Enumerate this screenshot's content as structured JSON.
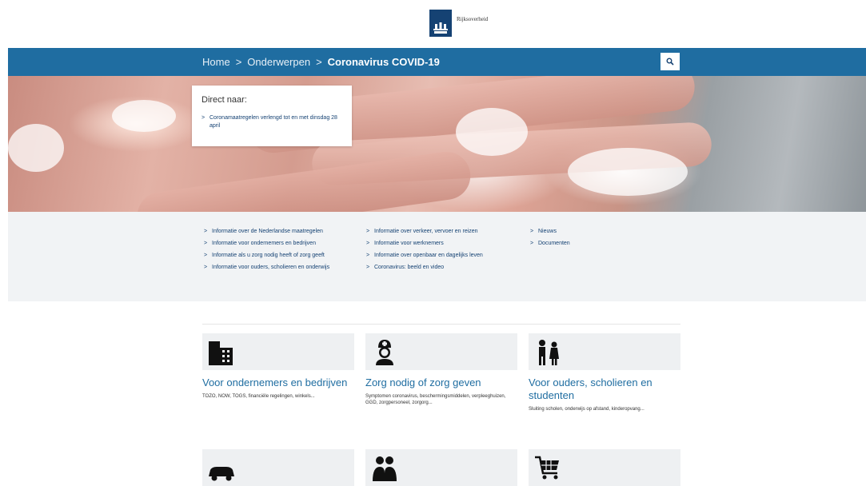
{
  "header": {
    "logo_text": "Rijksoverheid"
  },
  "navbar": {
    "breadcrumb": {
      "home": "Home",
      "section": "Onderwerpen",
      "current": "Coronavirus COVID-19",
      "separator": ">"
    },
    "search_icon": "search-icon"
  },
  "hero": {
    "direct_title": "Direct naar:",
    "direct_link": "Coronamaatregelen verlengd tot en met dinsdag 28 april"
  },
  "links": {
    "column1": [
      "Informatie over de Nederlandse maatregelen",
      "Informatie voor ondernemers en bedrijven",
      "Informatie als u zorg nodig heeft of zorg geeft",
      "Informatie voor ouders, scholieren en onderwijs"
    ],
    "column2": [
      "Informatie over verkeer, vervoer en reizen",
      "Informatie voor werknemers",
      "Informatie over openbaar en dagelijks leven",
      "Coronavirus: beeld en video"
    ],
    "column3": [
      "Nieuws",
      "Documenten"
    ],
    "chevron": ">"
  },
  "cards": [
    {
      "icon": "building-icon",
      "title": "Voor ondernemers en bedrijven",
      "desc": "TOZO, NOW, TOGS, financiële regelingen, winkels..."
    },
    {
      "icon": "nurse-icon",
      "title": "Zorg nodig of zorg geven",
      "desc": "Symptomen coronavirus, beschermingsmiddelen, verpleeghuizen, GGD, zorgpersoneel, zorgorg..."
    },
    {
      "icon": "parent-child-icon",
      "title": "Voor ouders, scholieren en studenten",
      "desc": "Sluiting scholen, onderwijs op afstand, kinderopvang..."
    },
    {
      "icon": "car-icon",
      "title": "",
      "desc": ""
    },
    {
      "icon": "people-icon",
      "title": "",
      "desc": ""
    },
    {
      "icon": "shopping-cart-icon",
      "title": "",
      "desc": ""
    }
  ],
  "colors": {
    "navbar": "#1f6da1",
    "brand": "#154273",
    "link_panel": "#f1f3f5",
    "card_title": "#1f6da1"
  }
}
